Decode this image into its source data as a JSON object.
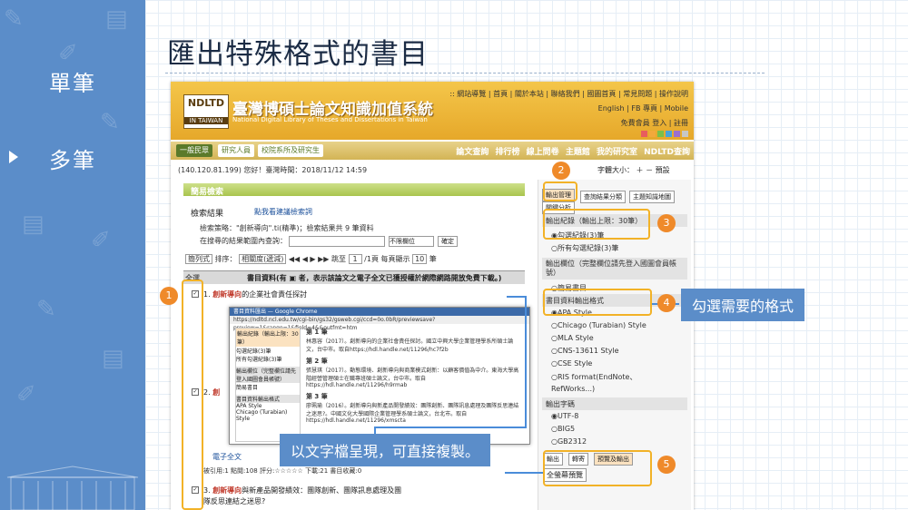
{
  "sidebar": {
    "items": [
      {
        "label": "單筆",
        "active": false
      },
      {
        "label": "多筆",
        "active": true
      }
    ]
  },
  "slide": {
    "title": "匯出特殊格式的書目"
  },
  "site": {
    "logo_main": "NDLTD",
    "logo_sub": "IN TAIWAN",
    "name": "臺灣博碩士論文知識加值系統",
    "name_en": "National Digital Library of Theses and Dissertations in Taiwan",
    "top_links": ":: 網站導覽 | 首頁 | 關於本站 | 聯絡我們 | 國圖首頁 | 常見問題 | 操作說明",
    "lang_links": "English | FB 專頁 | Mobile",
    "login_links": "免費會員  登入 | 註冊",
    "swatches": [
      "#e85d5d",
      "#f2a93b",
      "#7bbf4a",
      "#4aa3d9",
      "#9b6fcf",
      "#c7c7c7"
    ],
    "user_tabs": [
      "一般民眾",
      "研究人員",
      "校院系所及研究生"
    ],
    "main_nav": [
      "論文查詢",
      "排行榜",
      "線上問卷",
      "主題館",
      "我的研究室",
      "NDLTD查詢"
    ],
    "ip_line": "(140.120.81.199) 您好！臺灣時間：2018/11/12 14:59",
    "font_size": "字體大小：",
    "font_size_opts": [
      "＋",
      "－",
      "預設"
    ]
  },
  "search": {
    "section_label": "簡易檢索",
    "results_title": "檢索結果",
    "tips_link": "點我看建議檢索詞",
    "summary": "檢索策略：\"創新導向\".ti(精準)；檢索結果共 9 筆資料",
    "refine_label": "在搜尋的結果範圍內查詢：",
    "refine_value": "",
    "field_select": "不限欄位",
    "confirm_label": "確定",
    "sort_type": "簡列式",
    "sort_label": "排序：",
    "sort_value": "相關度(遞減)",
    "page_label": "跳至",
    "page_value": "1",
    "page_total": "/1頁",
    "per_page_label": "每頁顯示",
    "per_page_value": "10",
    "per_page_unit": "筆",
    "select_all": "全選",
    "table_header": "書目資料(有 ▣ 者，表示該論文之電子全文已獲授權於網際網路開放免費下載。)",
    "items": [
      {
        "num": "1.",
        "hl": "創新導向",
        "rest": "的企業社會責任探討",
        "checked": true
      },
      {
        "num": "2.",
        "hl": "創",
        "rest": "",
        "checked": true
      },
      {
        "num": "3.",
        "hl": "創新導向",
        "rest": "與新產品開發績效：團隊創新、團隊訊息處理及團隊反思連結之迷思?",
        "checked": true
      }
    ],
    "efulltext": "電子全文",
    "stats": "被引用:1  點閱:108  評分:☆☆☆☆☆  下載:21  書目收藏:0"
  },
  "popup": {
    "window_title": "書目資料匯出 — Google Chrome",
    "url": "https://ndltd.ncl.edu.tw/cgi-bin/gs32/gsweb.cgi/ccd=0o.0bR/previewsave?preview=1&range=1&field=4&&outfmt=htm",
    "left_opts": [
      "輸出紀錄（輸出上限：30筆）",
      "勾選紀錄(3)筆",
      "所有勾選紀錄(3)筆",
      "輸出欄位（完整欄位請先登入國圖會員帳號）",
      "簡易書目",
      "書目資料輸出格式",
      "APA Style",
      "Chicago (Turabian) Style"
    ],
    "records": [
      {
        "head": "第 1 筆",
        "text": "林惠容（2017）。創新導向的企業社會責任探討。國立中興大學企業管理學系所碩士論文，台中市。取自https://hdl.handle.net/11296/hc7f2b"
      },
      {
        "head": "第 2 筆",
        "text": "張慧琪（2017）。動態環境、創新導向與商業模式創新：以顧客價值為中介。東海大學高階經營管理碩士在職專班碩士論文，台中市。取自https://hdl.handle.net/11296/h9rmab"
      },
      {
        "head": "第 3 筆",
        "text": "廖珮瑜（2016）。創新導向與新產品開發績效：團隊創新、團隊訊息處理及團隊反思連結之迷思?。中國文化大學國際企業管理學系碩士論文，台北市。取自https://hdl.handle.net/11296/xmscta"
      }
    ]
  },
  "panel": {
    "tabs": [
      "輸出管理",
      "查詢結果分類",
      "主題知識地圖",
      "關鍵分析"
    ],
    "record_title": "輸出紀錄（輸出上限：30筆）",
    "record_opts": [
      "勾選紀錄(3)筆",
      "所有勾選紀錄(3)筆"
    ],
    "field_title": "輸出欄位（完整欄位請先登入國圖會員帳號）",
    "field_opts": [
      "簡易書目"
    ],
    "format_title": "書目資料輸出格式",
    "format_opts": [
      "APA Style",
      "Chicago (Turabian) Style",
      "MLA Style",
      "CNS-13611 Style",
      "CSE Style",
      "RIS format(EndNote、",
      "RefWorks...)"
    ],
    "charset_title": "輸出字碼",
    "charset_opts": [
      "UTF-8",
      "BIG5",
      "GB2312"
    ],
    "bottom_tabs": [
      "輸出",
      "轉寄",
      "預覽及輸出"
    ],
    "copy_button": "全螢幕預覽"
  },
  "annotations": {
    "markers": [
      "1",
      "2",
      "3",
      "4",
      "5"
    ],
    "callout_format": "勾選需要的格式",
    "callout_text": "以文字檔呈現，可直接複製。"
  }
}
